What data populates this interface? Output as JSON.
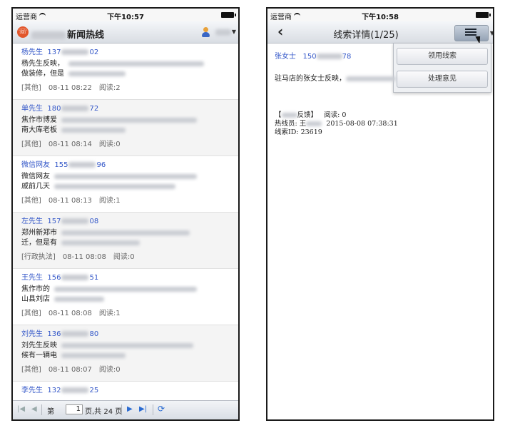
{
  "left": {
    "status": {
      "carrier": "运营商",
      "time": "下午10:57"
    },
    "header": {
      "title": "新闻热线"
    },
    "items": [
      {
        "name": "杨先生",
        "phone_prefix": "137",
        "phone_suffix": "02",
        "line1": "杨先生反映，",
        "line2": "做装修，但是",
        "category": "[其他]",
        "datetime": "08-11 08:22",
        "reads": "阅读:2"
      },
      {
        "name": "单先生",
        "phone_prefix": "180",
        "phone_suffix": "72",
        "line1": "焦作市博爱",
        "line2": "南大库老板",
        "category": "[其他]",
        "datetime": "08-11 08:14",
        "reads": "阅读:0"
      },
      {
        "name": "微信网友",
        "phone_prefix": "155",
        "phone_suffix": "96",
        "line1": "微信网友",
        "line2": "戚前几天",
        "category": "[其他]",
        "datetime": "08-11 08:13",
        "reads": "阅读:1"
      },
      {
        "name": "左先生",
        "phone_prefix": "157",
        "phone_suffix": "08",
        "line1": "郑州新郑市",
        "line2": "迁，但是有",
        "category": "[行政执法]",
        "datetime": "08-11 08:08",
        "reads": "阅读:0"
      },
      {
        "name": "王先生",
        "phone_prefix": "156",
        "phone_suffix": "51",
        "line1": "焦作市的",
        "line2": "山县刘店",
        "category": "[其他]",
        "datetime": "08-11 08:08",
        "reads": "阅读:1"
      },
      {
        "name": "刘先生",
        "phone_prefix": "136",
        "phone_suffix": "80",
        "line1": "刘先生反映",
        "line2": "候有一辆电",
        "category": "[其他]",
        "datetime": "08-11 08:07",
        "reads": "阅读:0"
      },
      {
        "name": "李先生",
        "phone_prefix": "132",
        "phone_suffix": "25",
        "line1": "",
        "line2": "",
        "category": "",
        "datetime": "",
        "reads": ""
      }
    ],
    "pager": {
      "page_label": "第",
      "page_value": "1",
      "total_label": "页,共 24 页"
    }
  },
  "right": {
    "status": {
      "carrier": "运营商",
      "time": "下午10:58"
    },
    "header": {
      "title": "线索详情(1/25)"
    },
    "menu": {
      "options": [
        "领用线索",
        "处理意见"
      ]
    },
    "detail": {
      "name": "张女士",
      "phone_prefix": "150",
      "phone_suffix": "78",
      "body": "驻马店的张女士反映，",
      "source_open": "【",
      "source_label": "反馈】",
      "reads": "阅读: 0",
      "operator_label": "热线员: 王",
      "timestamp": "2015-08-08 07:38:31",
      "lead_id": "线索ID: 23619"
    }
  },
  "colors": {
    "accent": "#3256c8",
    "logo": "#e2562b"
  }
}
